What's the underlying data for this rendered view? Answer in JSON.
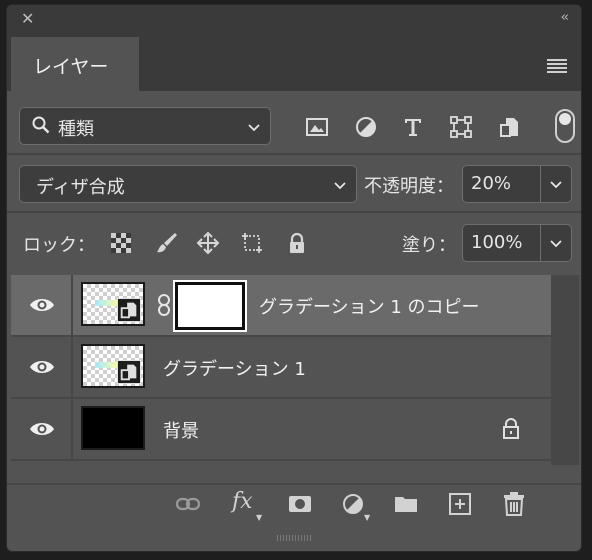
{
  "window": {
    "close_glyph": "✕",
    "collapse_glyph": "‹‹"
  },
  "panel": {
    "tab_label": "レイヤー",
    "menu_icon": "hamburger-icon"
  },
  "filter": {
    "kind_label": "種類",
    "icons": [
      "image-filter-icon",
      "adjustment-filter-icon",
      "type-filter-icon",
      "shape-filter-icon",
      "smart-object-filter-icon"
    ],
    "toggle": "on"
  },
  "blend": {
    "mode": "ディザ合成",
    "opacity_label": "不透明度：",
    "opacity_value": "20%"
  },
  "lock": {
    "label": "ロック：",
    "icons": [
      "lock-transparent-pixels-icon",
      "lock-image-pixels-icon",
      "lock-position-icon",
      "lock-artboard-icon",
      "lock-all-icon"
    ],
    "fill_label": "塗り：",
    "fill_value": "100%"
  },
  "layers": [
    {
      "name": "グラデーション 1 のコピー",
      "selected": true,
      "has_mask": true
    },
    {
      "name": "グラデーション 1",
      "selected": false,
      "has_mask": false
    },
    {
      "name": "背景",
      "selected": false,
      "has_mask": false,
      "locked": true
    }
  ],
  "bottom_icons": [
    "link-layers-icon",
    "fx-icon",
    "add-mask-icon",
    "new-adjustment-icon",
    "new-group-icon",
    "new-layer-icon",
    "delete-icon"
  ],
  "bottom_labels": {
    "fx": "fx"
  }
}
